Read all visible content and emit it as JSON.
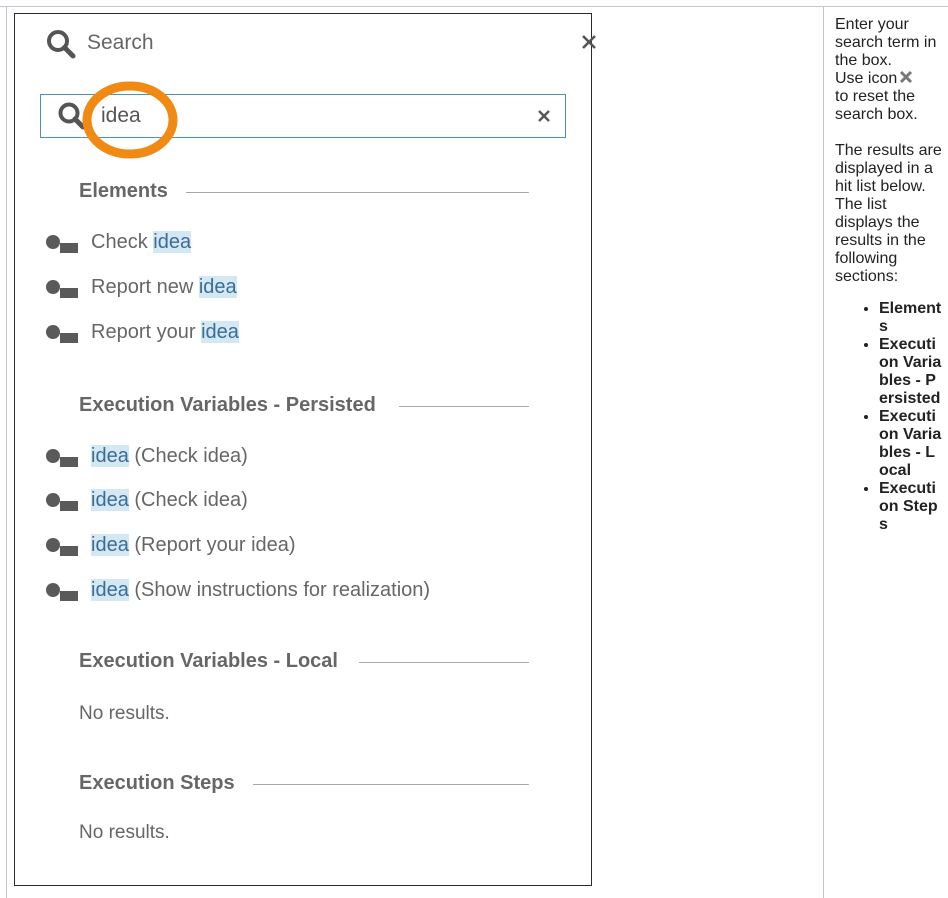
{
  "search_panel": {
    "title": "Search",
    "input_value": "idea"
  },
  "sections": {
    "elements": {
      "heading": "Elements",
      "results": [
        {
          "prefix": "Check ",
          "match": "idea",
          "suffix": ""
        },
        {
          "prefix": "Report new ",
          "match": "idea",
          "suffix": ""
        },
        {
          "prefix": "Report your ",
          "match": "idea",
          "suffix": ""
        }
      ]
    },
    "persisted": {
      "heading": "Execution Variables - Persisted",
      "results": [
        {
          "prefix": "",
          "match": "idea",
          "suffix": " (Check idea)"
        },
        {
          "prefix": "",
          "match": "idea",
          "suffix": " (Check idea)"
        },
        {
          "prefix": "",
          "match": "idea",
          "suffix": " (Report your idea)"
        },
        {
          "prefix": "",
          "match": "idea",
          "suffix": " (Show instructions for realization)"
        }
      ]
    },
    "local": {
      "heading": "Execution Variables - Local",
      "empty_text": "No results."
    },
    "steps": {
      "heading": "Execution Steps",
      "empty_text": "No results."
    }
  },
  "help": {
    "intro": "Enter your search term in the box.",
    "icon_prefix": "Use icon",
    "icon_suffix": "to reset the search box.",
    "results_text": "The results are displayed in a hit list below. The list displays the results in the following sections:",
    "section_list": [
      "Elements",
      "Execution Variables - Persisted",
      "Execution Variables - Local",
      "Execution Steps"
    ]
  },
  "colors": {
    "highlight_ring": "#f08a12",
    "match_highlight": "#d4e8f4",
    "input_border": "#4a90b8"
  }
}
